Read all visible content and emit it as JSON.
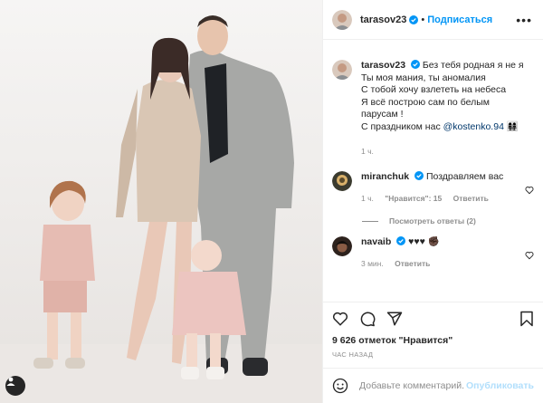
{
  "colors": {
    "accent": "#0095f6",
    "link": "#00376b",
    "muted": "#8e8e8e",
    "text": "#262626",
    "publish_disabled": "#b2dffc"
  },
  "photo": {
    "alt_icon": "user-tag-icon"
  },
  "header": {
    "username": "tarasov23",
    "separator": "•",
    "follow_label": "Подписаться",
    "more_label": "•••"
  },
  "caption": {
    "username": "tarasov23",
    "lines": [
      "Без тебя родная я не я",
      "Ты моя мания, ты аномалия",
      "С тобой хочу взлететь на небеса",
      "Я всё построю сам по белым",
      "парусам !",
      "С праздником нас"
    ],
    "mention": "@kostenko.94",
    "emoji": "👩‍👩‍👧‍👧",
    "time": "1 ч."
  },
  "comments": [
    {
      "username": "miranchuk",
      "text": "Поздравляем вас",
      "emoji": "",
      "time": "1 ч.",
      "likes": "\"Нравится\": 15",
      "reply": "Ответить",
      "replies_label": "Посмотреть ответы (2)"
    },
    {
      "username": "navaib",
      "text": "♥♥♥",
      "emoji": "✊🏿",
      "time": "3 мин.",
      "reply": "Ответить"
    }
  ],
  "actions": {
    "likes_text": "9 626 отметок \"Нравится\"",
    "posted": "ЧАС НАЗАД",
    "comment_placeholder": "Добавьте комментарий...",
    "publish_label": "Опубликовать"
  }
}
